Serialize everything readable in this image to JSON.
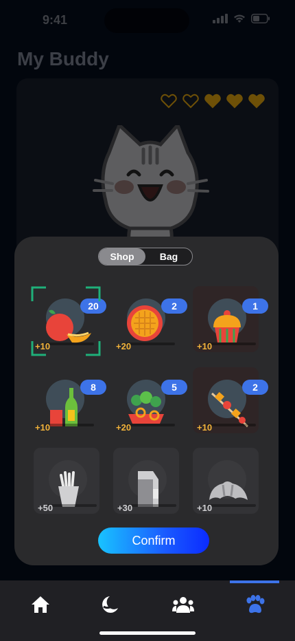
{
  "status": {
    "time": "9:41"
  },
  "page": {
    "title": "My Buddy"
  },
  "hearts": {
    "filled": 3,
    "total": 5
  },
  "sheet": {
    "tabs": [
      {
        "label": "Shop",
        "active": false
      },
      {
        "label": "Bag",
        "active": true
      }
    ],
    "items": [
      {
        "name": "food-item-fruit",
        "count": "20",
        "reward": "+10",
        "locked": false,
        "selected": true
      },
      {
        "name": "food-item-waffle",
        "count": "2",
        "reward": "+20",
        "locked": false,
        "selected": false
      },
      {
        "name": "food-item-cupcake",
        "count": "1",
        "reward": "+10",
        "locked": false,
        "selected": false
      },
      {
        "name": "food-item-drink",
        "count": "8",
        "reward": "+10",
        "locked": false,
        "selected": false
      },
      {
        "name": "food-item-salad",
        "count": "5",
        "reward": "+20",
        "locked": false,
        "selected": false
      },
      {
        "name": "food-item-skewer",
        "count": "2",
        "reward": "+10",
        "locked": false,
        "selected": false
      },
      {
        "name": "food-item-fries",
        "count": "",
        "reward": "+50",
        "locked": true,
        "selected": false
      },
      {
        "name": "food-item-milk",
        "count": "",
        "reward": "+30",
        "locked": true,
        "selected": false
      },
      {
        "name": "food-item-croissant",
        "count": "",
        "reward": "+10",
        "locked": true,
        "selected": false
      }
    ],
    "confirm_label": "Confirm"
  },
  "nav": {
    "items": [
      {
        "icon": "home-icon",
        "active": false
      },
      {
        "icon": "moon-icon",
        "active": false
      },
      {
        "icon": "friends-icon",
        "active": false
      },
      {
        "icon": "paw-icon",
        "active": true
      }
    ]
  },
  "colors": {
    "accent": "#3d73e8",
    "reward": "#f1b23a",
    "heart": "#c8920e"
  }
}
